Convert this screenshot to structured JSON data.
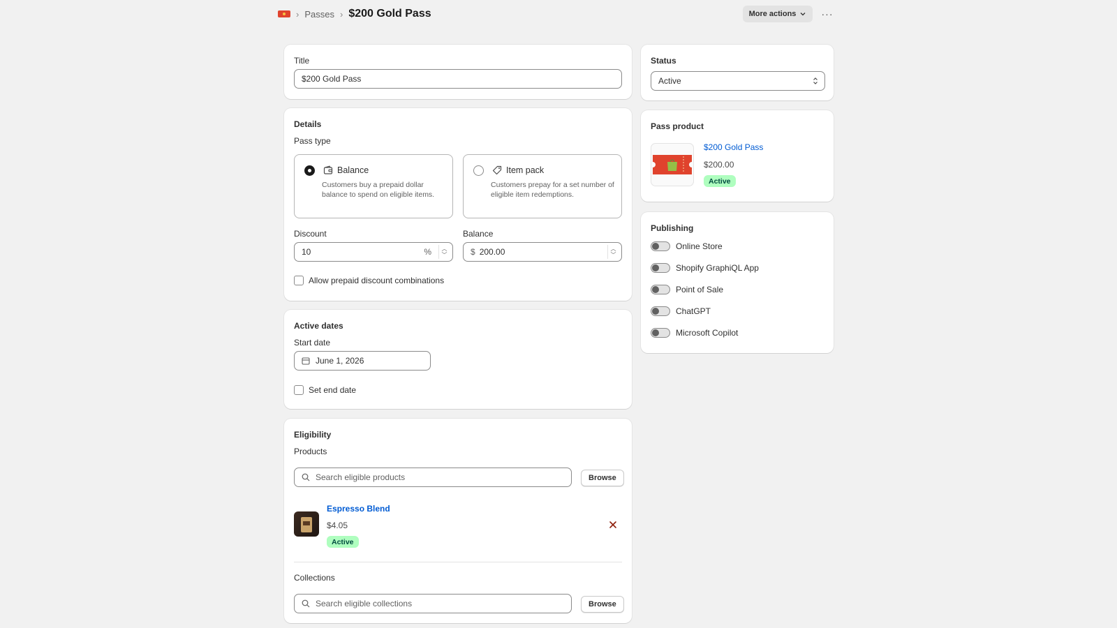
{
  "header": {
    "breadcrumb_parent": "Passes",
    "title": "$200 Gold Pass",
    "more_actions_label": "More actions",
    "overflow_label": "···"
  },
  "title_card": {
    "label": "Title",
    "value": "$200 Gold Pass"
  },
  "details": {
    "heading": "Details",
    "pass_type_label": "Pass type",
    "options": [
      {
        "title": "Balance",
        "description": "Customers buy a prepaid dollar balance to spend on eligible items.",
        "selected": true,
        "icon": "wallet-icon"
      },
      {
        "title": "Item pack",
        "description": "Customers prepay for a set number of eligible item redemptions.",
        "selected": false,
        "icon": "tag-icon"
      }
    ],
    "discount_label": "Discount",
    "discount_value": "10",
    "discount_suffix": "%",
    "balance_label": "Balance",
    "balance_prefix": "$",
    "balance_value": "200.00",
    "allow_combinations_label": "Allow prepaid discount combinations"
  },
  "active_dates": {
    "heading": "Active dates",
    "start_label": "Start date",
    "start_value": "June 1, 2026",
    "end_label": "Set end date"
  },
  "eligibility": {
    "heading": "Eligibility",
    "products_label": "Products",
    "products_placeholder": "Search eligible products",
    "browse_label": "Browse",
    "product": {
      "name": "Espresso Blend",
      "price": "$4.05",
      "status": "Active"
    },
    "collections_label": "Collections",
    "collections_placeholder": "Search eligible collections"
  },
  "status": {
    "heading": "Status",
    "value": "Active"
  },
  "pass_product": {
    "heading": "Pass product",
    "name": "$200 Gold Pass",
    "price": "$200.00",
    "status": "Active"
  },
  "publishing": {
    "heading": "Publishing",
    "channels": [
      "Online Store",
      "Shopify GraphiQL App",
      "Point of Sale",
      "ChatGPT",
      "Microsoft Copilot"
    ]
  },
  "colors": {
    "background": "#f1f1f1",
    "link": "#005bd3",
    "badge_success_bg": "#affebf",
    "remove_icon": "#8e1f0b",
    "ticket": "#e0432d"
  }
}
